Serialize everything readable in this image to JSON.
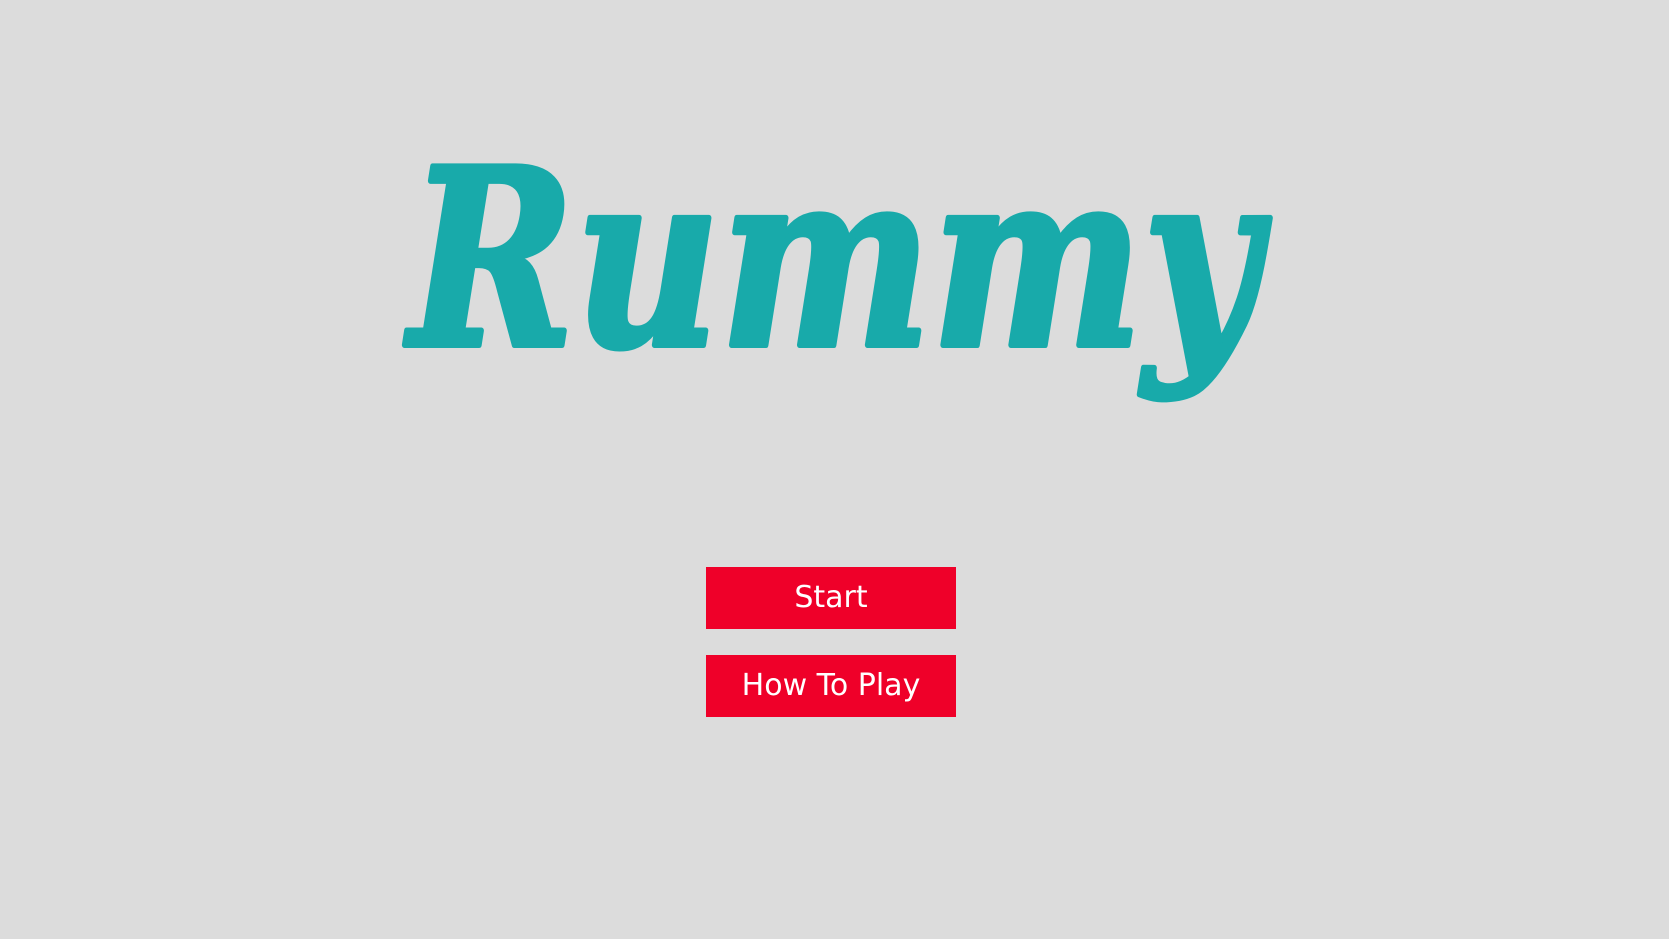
{
  "title": {
    "text": "Rummy",
    "color": "#18aaaa"
  },
  "background_color": "#dcdcdc",
  "button_color": "#ef0029",
  "menu": {
    "start_label": "Start",
    "how_to_play_label": "How To Play"
  }
}
